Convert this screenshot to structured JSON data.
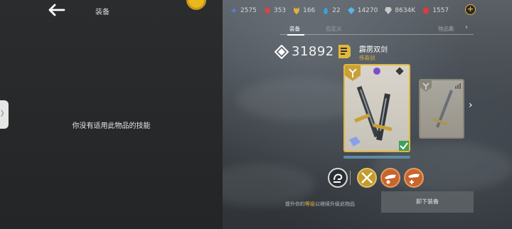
{
  "header": {
    "title": "装备",
    "currencies": [
      {
        "icon": "blue-star-icon",
        "value": "2575",
        "color": "#5b7be0"
      },
      {
        "icon": "red-leaf-icon",
        "value": "353",
        "color": "#d64545"
      },
      {
        "icon": "gold-leaf-icon",
        "value": "166",
        "color": "#e0b43a"
      },
      {
        "icon": "blue-flame-icon",
        "value": "22",
        "color": "#3aa0e0"
      },
      {
        "icon": "blue-gem-icon",
        "value": "14270",
        "color": "#5ab4e8"
      },
      {
        "icon": "crystal-icon",
        "value": "8634K",
        "color": "#c9c9c9"
      },
      {
        "icon": "red-gem-icon",
        "value": "1557",
        "color": "#e03a3a"
      }
    ],
    "plus_label": "+"
  },
  "left": {
    "side_tab_label": "〉",
    "no_skill_text": "你没有适用此物品的技能"
  },
  "tabs": {
    "equip": "装备",
    "custom": "自定义",
    "collection": "物品集",
    "chevron": "›"
  },
  "item": {
    "power": "31892",
    "name": "霹雳双剑",
    "rarity": "传奇剑"
  },
  "nav": {
    "next": "›"
  },
  "footer": {
    "hint_prefix": "提升你的",
    "hint_highlight": "等级",
    "hint_suffix": "以继续升级此物品",
    "unequip": "卸下装备"
  },
  "colors": {
    "accent_gold": "#e1b73e",
    "rarity_gold": "#e3b43a"
  }
}
